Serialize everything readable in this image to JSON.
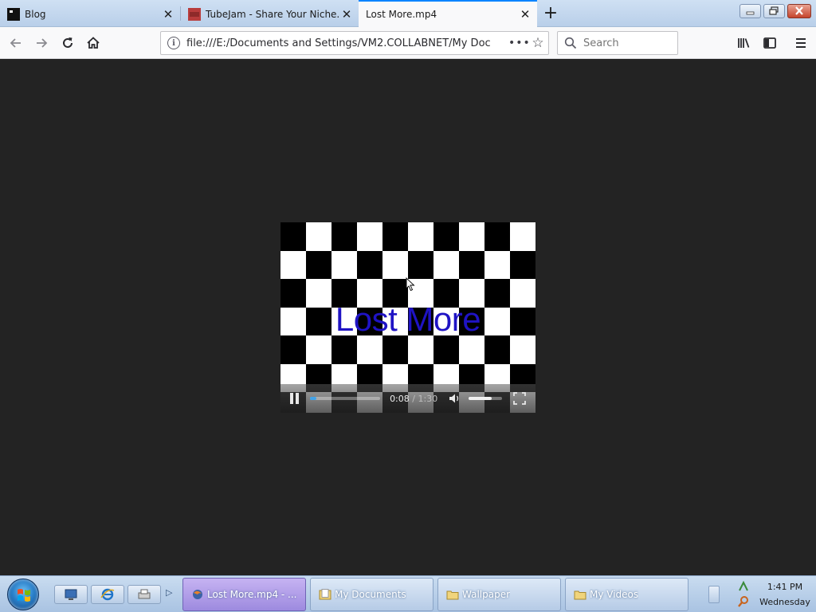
{
  "browser": {
    "tabs": [
      {
        "title": "Blog",
        "active": false
      },
      {
        "title": "TubeJam - Share Your Niche.",
        "active": false
      },
      {
        "title": "Lost More.mp4",
        "active": true
      }
    ],
    "address": "file:///E:/Documents and Settings/VM2.COLLABNET/My Doc",
    "search_placeholder": "Search"
  },
  "video": {
    "title_text": "Lost More",
    "current_time": "0:08",
    "time_separator": "/",
    "duration": "1:30",
    "progress": 0.09,
    "volume": 0.7
  },
  "taskbar": {
    "items": [
      {
        "label": "Lost More.mp4 - ...",
        "active": true
      },
      {
        "label": "My Documents",
        "active": false
      },
      {
        "label": "Wallpaper",
        "active": false
      },
      {
        "label": "My Videos",
        "active": false
      }
    ],
    "clock_time": "1:41 PM",
    "clock_day": "Wednesday"
  },
  "colors": {
    "accent": "#0a84ff",
    "page_bg": "#232323",
    "video_title": "#1f13c4",
    "progress_fill": "#43a3e8"
  }
}
